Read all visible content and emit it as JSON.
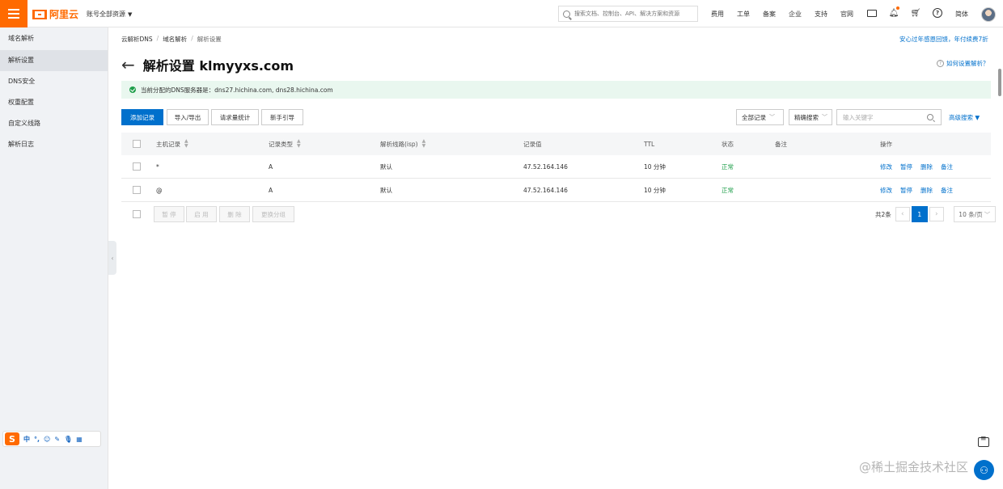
{
  "topbar": {
    "logo_text": "阿里云",
    "account_label": "账号全部资源",
    "search_placeholder": "搜索文档、控制台、API、解决方案和资源",
    "nav": [
      "费用",
      "工单",
      "备案",
      "企业",
      "支持",
      "官网"
    ],
    "language": "简体"
  },
  "sidebar": {
    "title": "域名解析",
    "items": [
      {
        "label": "解析设置",
        "active": true
      },
      {
        "label": "DNS安全",
        "active": false
      },
      {
        "label": "权重配置",
        "active": false
      },
      {
        "label": "自定义线路",
        "active": false
      },
      {
        "label": "解析日志",
        "active": false
      }
    ]
  },
  "breadcrumb": [
    "云解析DNS",
    "域名解析",
    "解析设置"
  ],
  "promo_link": "安心过年感恩回馈，年付续费7折",
  "page": {
    "title": "解析设置 klmyyxs.com",
    "help_link": "如何设置解析？",
    "notice": "当前分配的DNS服务器是：dns27.hichina.com, dns28.hichina.com"
  },
  "toolbar": {
    "add_record": "添加记录",
    "import_export": "导入/导出",
    "query_stats": "请求量统计",
    "guide": "新手引导",
    "filter_select": "全部记录",
    "search_mode": "精确搜索",
    "keyword_placeholder": "输入关键字",
    "advanced_search": "高级搜索"
  },
  "table": {
    "headers": [
      "主机记录",
      "记录类型",
      "解析线路(isp)",
      "记录值",
      "TTL",
      "状态",
      "备注",
      "操作"
    ],
    "rows": [
      {
        "host": "*",
        "type": "A",
        "line": "默认",
        "value": "47.52.164.146",
        "ttl": "10 分钟",
        "status": "正常",
        "remark": ""
      },
      {
        "host": "@",
        "type": "A",
        "line": "默认",
        "value": "47.52.164.146",
        "ttl": "10 分钟",
        "status": "正常",
        "remark": ""
      }
    ],
    "actions": [
      "修改",
      "暂停",
      "删除",
      "备注"
    ]
  },
  "bulk": {
    "pause": "暂 停",
    "enable": "启 用",
    "delete": "删 除",
    "change_line": "更换分组"
  },
  "pagination": {
    "total": "共2条",
    "current_page": "1",
    "page_size": "10 条/页"
  },
  "ime": {
    "logo": "S",
    "mode": "中"
  },
  "watermark": "@稀土掘金技术社区",
  "colors": {
    "brand": "#ff6a00",
    "primary": "#0070cc",
    "success": "#1e9e4a"
  }
}
